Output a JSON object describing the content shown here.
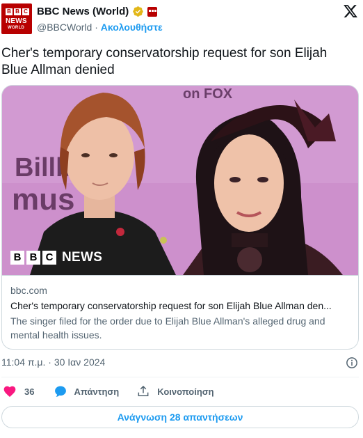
{
  "account": {
    "name": "BBC News (World)",
    "handle": "@BBCWorld",
    "separator": " · ",
    "follow_label": "Ακολουθήστε",
    "avatar_blocks": [
      "B",
      "B",
      "C"
    ],
    "avatar_line1": "NEWS",
    "avatar_line2": "WORLD"
  },
  "tweet": {
    "text": "Cher's temporary conservatorship request for son Elijah Blue Allman denied"
  },
  "card": {
    "image_badge_blocks": [
      "B",
      "B",
      "C"
    ],
    "image_badge_word": "NEWS",
    "image_sign_top": "on FOX",
    "image_sign_left": "Billbo",
    "image_sign_left2": "mus",
    "domain": "bbc.com",
    "title": "Cher's temporary conservatorship request for son Elijah Blue Allman den...",
    "description": "The singer filed for the order due to Elijah Blue Allman's alleged drug and mental health issues."
  },
  "timestamp": "11:04 π.μ. · 30 Ιαν 2024",
  "actions": {
    "like_count": "36",
    "reply_label": "Απάντηση",
    "share_label": "Κοινοποίηση"
  },
  "read_replies_label": "Ανάγνωση 28 απαντήσεων",
  "colors": {
    "bbc_red": "#b80000",
    "link_blue": "#1d9bf0",
    "like_pink": "#f91880",
    "verified_gold": "#e2b719",
    "muted_text": "#536471"
  }
}
